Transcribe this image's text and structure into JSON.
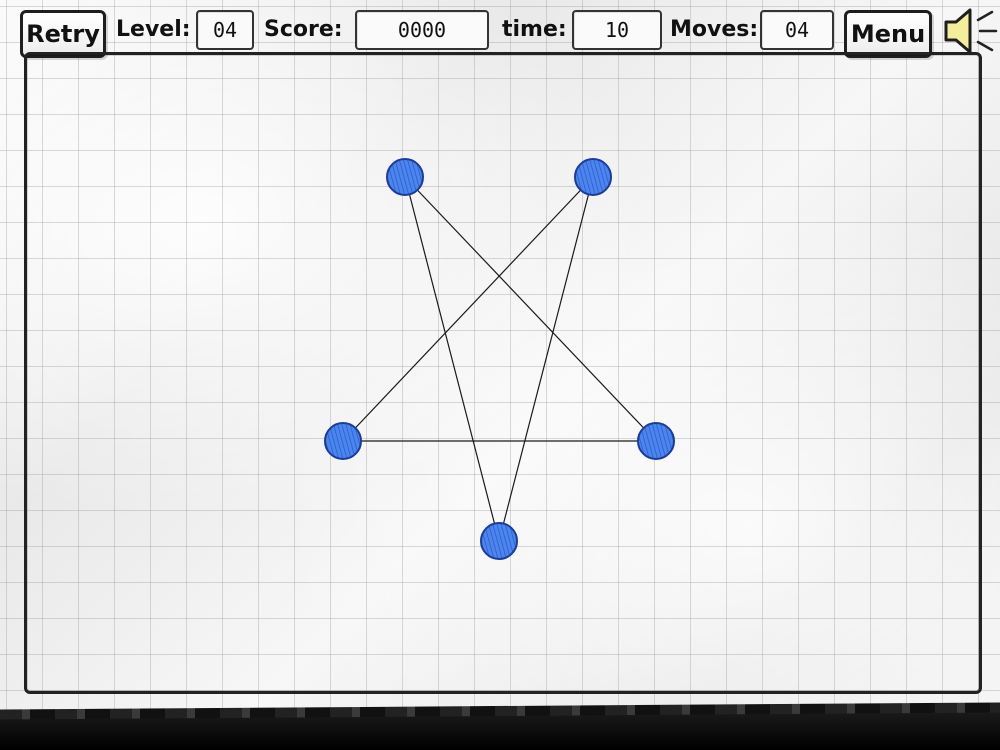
{
  "hud": {
    "retry_label": "Retry",
    "level_label": "Level:",
    "level_value": "04",
    "score_label": "Score:",
    "score_value": "0000",
    "time_label": "time:",
    "time_value": "10",
    "moves_label": "Moves:",
    "moves_value": "04",
    "menu_label": "Menu"
  },
  "icons": {
    "sound": "speaker-icon"
  },
  "colors": {
    "node_fill": "#3c78e6",
    "node_stroke": "#1c3c9c",
    "line": "#1a1a1a"
  }
}
